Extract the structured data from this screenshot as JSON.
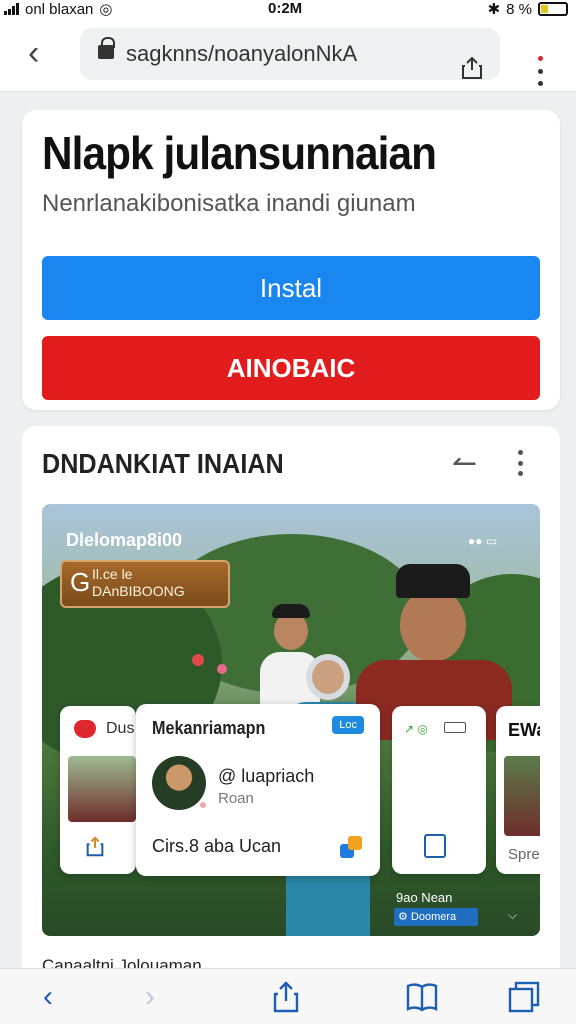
{
  "status_bar": {
    "carrier": "onl blaxan",
    "time": "0:2M",
    "battery": "8 %"
  },
  "url_bar": {
    "url": "sagknns/noanyalonNkA"
  },
  "app_card": {
    "title": "Nlapk julansunnaian",
    "subtitle": "Nenrlanakibonisatka inandi giunam",
    "install_label": "Instal",
    "secondary_label": "AINOBAIC"
  },
  "section": {
    "title": "DNDANKIAT INAIAN",
    "hero_label": "Dlelomap8i00",
    "badge_line1": "Il.ce le",
    "badge_line2": "DAnBIBOONG",
    "left_card": {
      "text": "Dus"
    },
    "main_card": {
      "title": "Mekanriamapn",
      "tag": "Loc",
      "name": "@ luapriach",
      "sub": "Roan",
      "footer": "Cirs.8 aba Ucan"
    },
    "edge_card": {
      "title": "EWa",
      "text": "Spre"
    },
    "download_label": "9ao Nean",
    "download_button": "⚙ Doomera",
    "caption": "Canaaltni Jolouaman"
  },
  "colors": {
    "install": "#1a86f0",
    "secondary": "#e21c1c",
    "link": "#1e5fb3"
  }
}
